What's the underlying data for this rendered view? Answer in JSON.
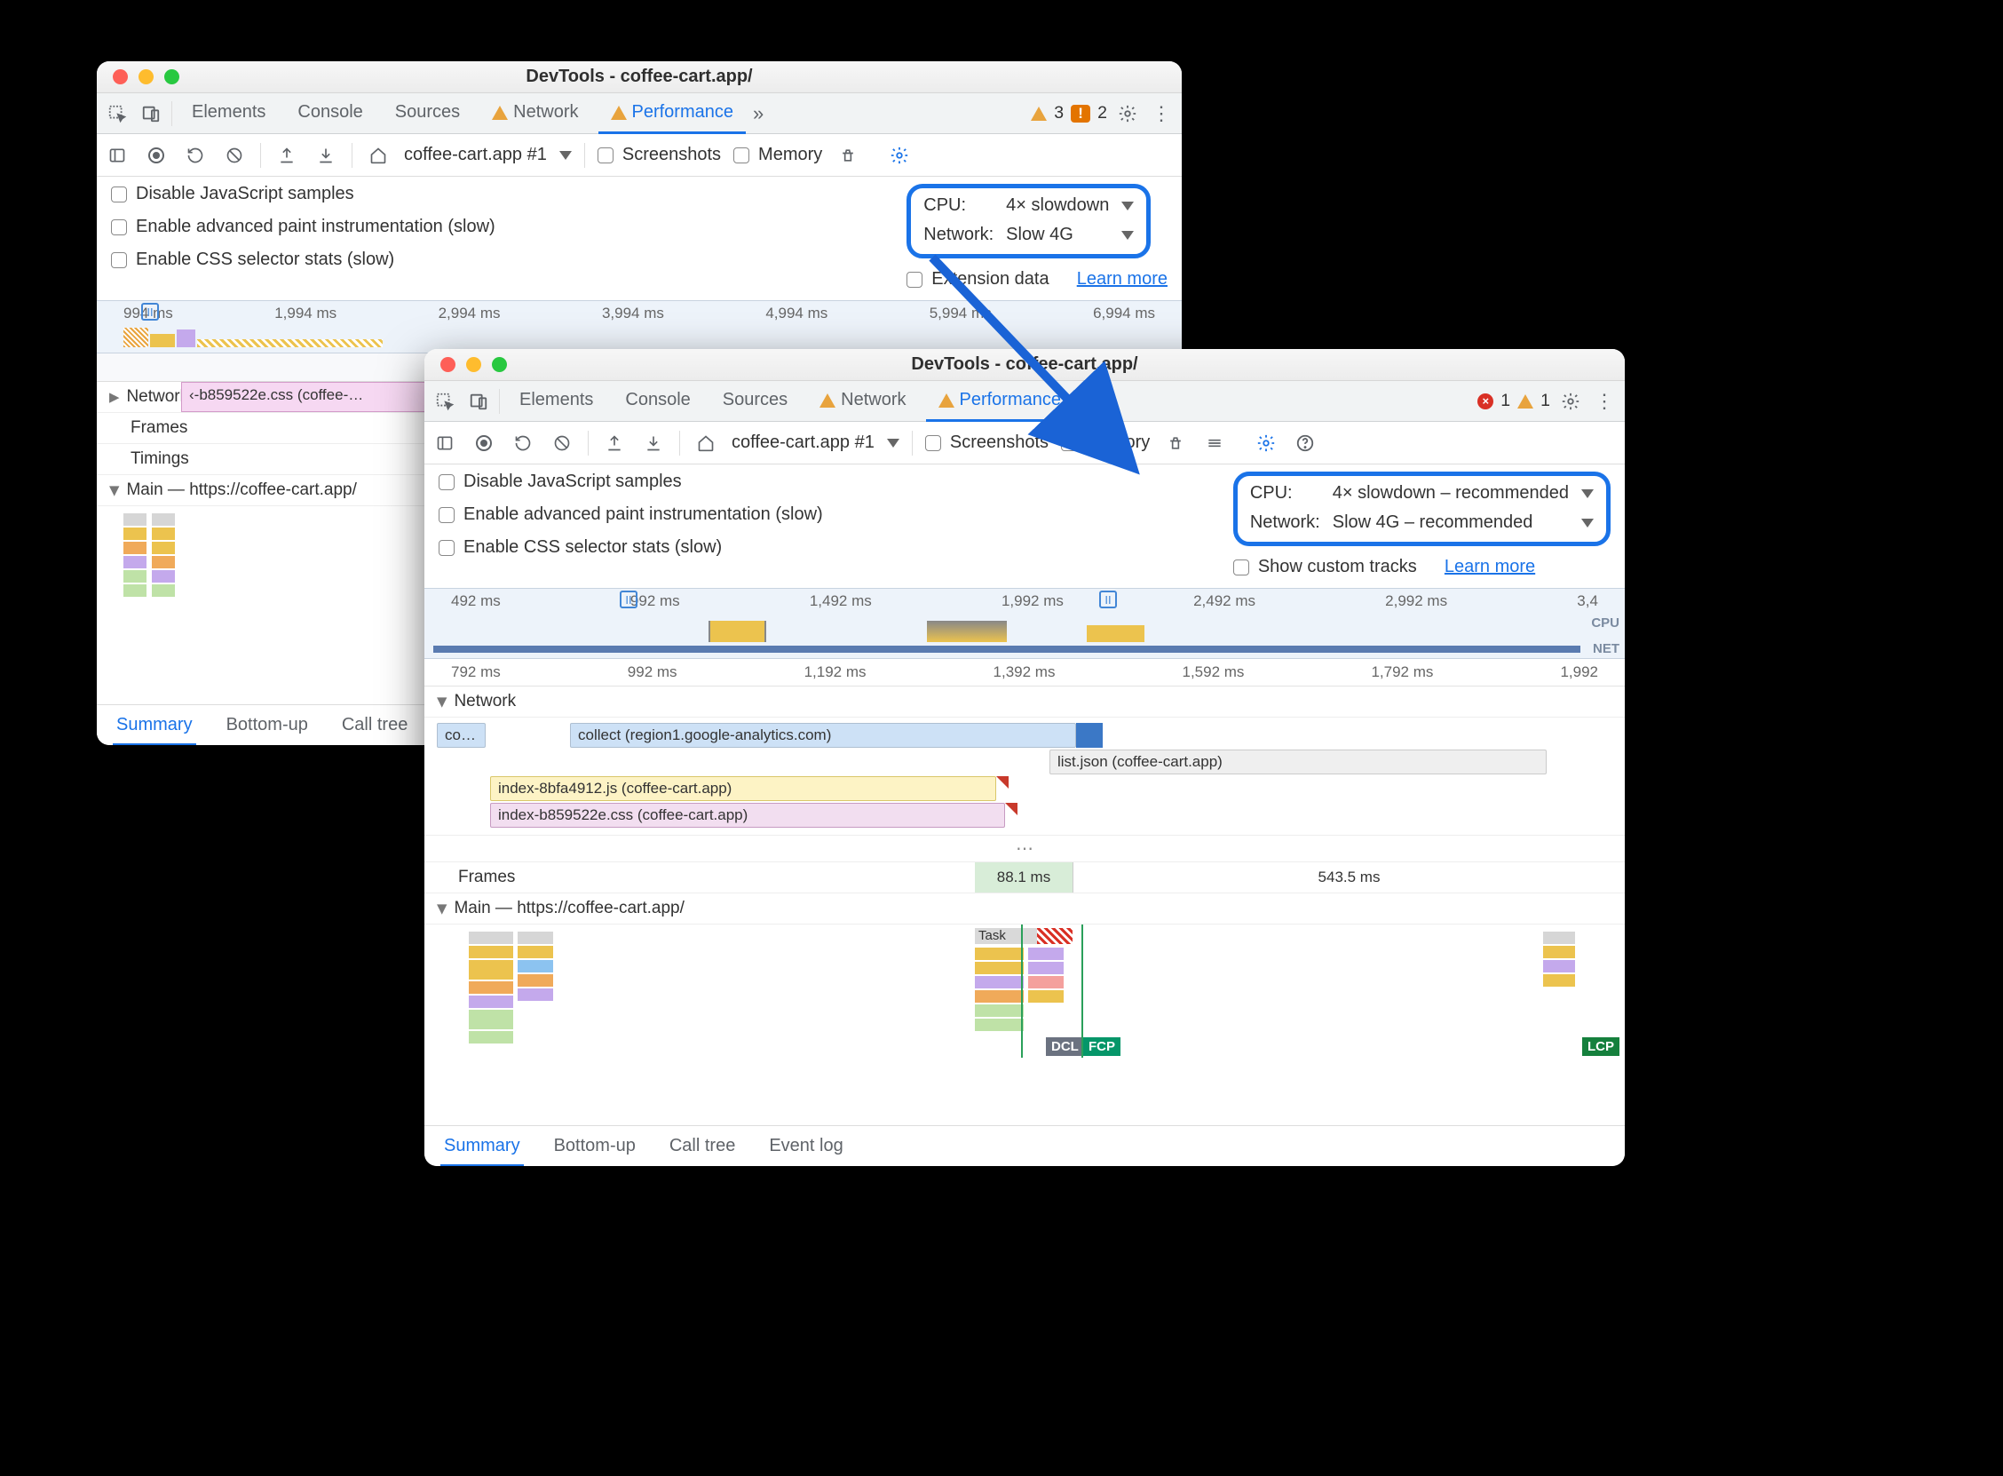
{
  "window1": {
    "title": "DevTools - coffee-cart.app/",
    "tabs": {
      "elements": "Elements",
      "console": "Console",
      "sources": "Sources",
      "network": "Network",
      "performance": "Performance"
    },
    "issue_error_count": "3",
    "issue_warn_count": "2",
    "recording_select": "coffee-cart.app #1",
    "screenshots": "Screenshots",
    "memory": "Memory",
    "checks": {
      "disable_js": "Disable JavaScript samples",
      "paint_instr": "Enable advanced paint instrumentation (slow)",
      "css_stats": "Enable CSS selector stats (slow)"
    },
    "throttle": {
      "cpu_label": "CPU:",
      "cpu_value": "4× slowdown",
      "net_label": "Network:",
      "net_value": "Slow 4G"
    },
    "ext_data": "Extension data",
    "learn_more": "Learn more",
    "ruler": [
      "994 ms",
      "1,994 ms",
      "2,994 ms",
      "3,994 ms",
      "4,994 ms",
      "5,994 ms",
      "6,994 ms"
    ],
    "ruler2_single": "994 ms",
    "track_network": "Network",
    "track_network_item": "‹-b859522e.css (coffee-…",
    "track_frames": "Frames",
    "track_timings": "Timings",
    "track_main": "Main — https://coffee-cart.app/",
    "bottomtabs": {
      "summary": "Summary",
      "bottomup": "Bottom-up",
      "calltree": "Call tree"
    }
  },
  "window2": {
    "title": "DevTools - coffee-cart.app/",
    "tabs": {
      "elements": "Elements",
      "console": "Console",
      "sources": "Sources",
      "network": "Network",
      "performance": "Performance"
    },
    "issue_error_count": "1",
    "issue_warn_count": "1",
    "recording_select": "coffee-cart.app #1",
    "screenshots": "Screenshots",
    "memory": "Memory",
    "checks": {
      "disable_js": "Disable JavaScript samples",
      "paint_instr": "Enable advanced paint instrumentation (slow)",
      "css_stats": "Enable CSS selector stats (slow)"
    },
    "throttle": {
      "cpu_label": "CPU:",
      "cpu_value": "4× slowdown – recommended",
      "net_label": "Network:",
      "net_value": "Slow 4G – recommended"
    },
    "show_custom": "Show custom tracks",
    "learn_more": "Learn more",
    "ruler_top": [
      "492 ms",
      "992 ms",
      "1,492 ms",
      "1,992 ms",
      "2,492 ms",
      "2,992 ms",
      "3,4"
    ],
    "ruler_mid": [
      "792 ms",
      "992 ms",
      "1,192 ms",
      "1,392 ms",
      "1,592 ms",
      "1,792 ms",
      "1,992"
    ],
    "side_cpu": "CPU",
    "side_net": "NET",
    "track_network": "Network",
    "net_items": {
      "co": "co…",
      "collect": "collect (region1.google-analytics.com)",
      "listjson": "list.json (coffee-cart.app)",
      "indexjs": "index-8bfa4912.js (coffee-cart.app)",
      "indexcss": "index-b859522e.css (coffee-cart.app)"
    },
    "frames": "Frames",
    "frame_a": "88.1 ms",
    "frame_b": "543.5 ms",
    "track_main": "Main — https://coffee-cart.app/",
    "task": "Task",
    "dcl": "DCL",
    "fcp": "FCP",
    "lcp": "LCP",
    "bottomtabs": {
      "summary": "Summary",
      "bottomup": "Bottom-up",
      "calltree": "Call tree",
      "eventlog": "Event log"
    }
  }
}
